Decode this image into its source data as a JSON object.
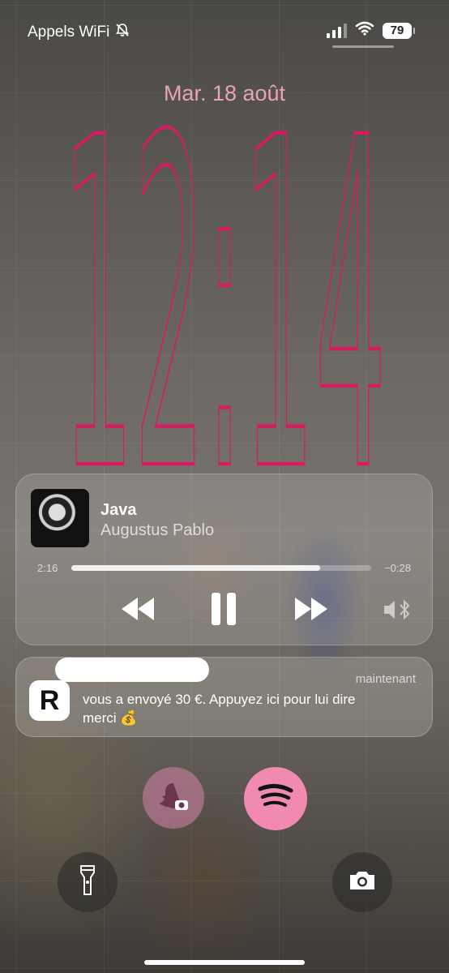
{
  "status_bar": {
    "carrier": "Appels WiFi",
    "battery": "79",
    "icons": [
      "bell-slash-icon",
      "cellular-signal-icon",
      "wifi-icon",
      "battery-icon"
    ]
  },
  "lock_screen": {
    "date": "Mar. 18 août",
    "time": "12:14",
    "accent_color": "#d81b60"
  },
  "now_playing": {
    "title": "Java",
    "artist": "Augustus Pablo",
    "elapsed": "2:16",
    "remaining": "−0:28",
    "progress_fraction": 0.83,
    "controls": [
      "rewind-icon",
      "pause-icon",
      "fast-forward-icon",
      "bluetooth-speaker-icon"
    ]
  },
  "notification": {
    "app_icon_letter": "R",
    "time": "maintenant",
    "body": "vous a envoyé 30 €. Appuyez ici pour lui dire merci 💰"
  },
  "shortcuts": {
    "left_app": "snapchat-camera-icon",
    "right_app": "spotify-icon",
    "flashlight": "flashlight-icon",
    "camera": "camera-icon",
    "accent_pink": "#f08ab0"
  }
}
